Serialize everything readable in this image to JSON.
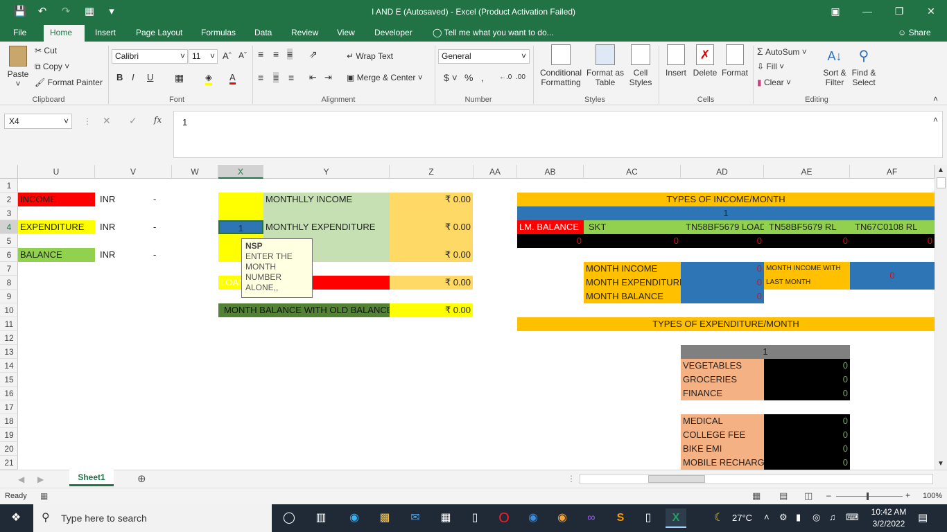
{
  "title": "I AND E (Autosaved) - Excel (Product Activation Failed)",
  "tabs": [
    "File",
    "Home",
    "Insert",
    "Page Layout",
    "Formulas",
    "Data",
    "Review",
    "View",
    "Developer"
  ],
  "tell_me": "Tell me what you want to do...",
  "share": "Share",
  "ribbon": {
    "paste": "Paste",
    "cut": "Cut",
    "copy": "Copy",
    "format_painter": "Format Painter",
    "clipboard": "Clipboard",
    "font_name": "Calibri",
    "font_size": "11",
    "font": "Font",
    "wrap_text": "Wrap Text",
    "merge_center": "Merge & Center",
    "alignment": "Alignment",
    "number_format": "General",
    "number": "Number",
    "cond_fmt_1": "Conditional",
    "cond_fmt_2": "Formatting",
    "fmt_table_1": "Format as",
    "fmt_table_2": "Table",
    "cell_styles_1": "Cell",
    "cell_styles_2": "Styles",
    "styles": "Styles",
    "insert": "Insert",
    "delete": "Delete",
    "format": "Format",
    "cells": "Cells",
    "autosum": "AutoSum",
    "fill": "Fill",
    "clear": "Clear",
    "sort_1": "Sort &",
    "sort_2": "Filter",
    "find_1": "Find &",
    "find_2": "Select",
    "editing": "Editing"
  },
  "name_box": "X4",
  "formula": "1",
  "columns": [
    "U",
    "V",
    "W",
    "X",
    "Y",
    "Z",
    "AA",
    "AB",
    "AC",
    "AD",
    "AE",
    "AF"
  ],
  "rows": [
    "1",
    "2",
    "3",
    "4",
    "5",
    "6",
    "7",
    "8",
    "9",
    "10",
    "11",
    "12",
    "13",
    "14",
    "15",
    "16",
    "17",
    "18",
    "19",
    "20",
    "21"
  ],
  "cells": {
    "u2": "INCOME",
    "v2": "INR",
    "w2": "-",
    "u4": "EXPENDITURE",
    "v4": "INR",
    "w4": "-",
    "u6": "BALANCE",
    "v6": "INR",
    "w6": "-",
    "y2": "MONTHLLY INCOME",
    "z2": "₹ 0.00",
    "x4": "1",
    "y4": "MONTHLY EXPENDITURE",
    "z4": "₹ 0.00",
    "y6": "BALANCE",
    "z6": "₹ 0.00",
    "x8": "LOAN",
    "y8": "LOAN",
    "z8": "₹ 0.00",
    "x10": "MONTH BALANCE WITH OLD BALANCE",
    "z10": "₹ 0.00",
    "ab2": "TYPES OF INCOME/MONTH",
    "ab3": "1",
    "ab4": "LM. BALANCE",
    "ac4": "SKT",
    "ad4": "TN58BF5679 LOAD",
    "ae4": "TN58BF5679 RL",
    "af4": "TN67C0108 RL",
    "ab5": "0",
    "ac5": "0",
    "ad5": "0",
    "ae5": "0",
    "af5": "0",
    "ac7": "MONTH INCOME",
    "ad7": "0",
    "ac8": "MONTH EXPENDITURE",
    "ad8": "0",
    "ac9": "MONTH BALANCE",
    "ad9": "0",
    "ae7a": "MONTH INCOME WITH",
    "ae7b": "LAST MONTH BALANCES",
    "af7": "0",
    "ab11": "TYPES OF EXPENDITURE/MONTH",
    "ad13": "1",
    "exp": [
      [
        "VEGETABLES",
        "0"
      ],
      [
        "GROCERIES",
        "0"
      ],
      [
        "FINANCE",
        "0"
      ],
      [
        "",
        ""
      ],
      [
        "MEDICAL",
        "0"
      ],
      [
        "COLLEGE FEE",
        "0"
      ],
      [
        "BIKE EMI",
        "0"
      ],
      [
        "MOBILE RECHARGE",
        "0"
      ]
    ]
  },
  "tooltip": {
    "title": "NSP",
    "body": "ENTER THE MONTH NUMBER ALONE,,"
  },
  "sheet_tab": "Sheet1",
  "status": "Ready",
  "zoom": "100%",
  "taskbar": {
    "search": "Type here to search",
    "temp": "27°C",
    "time": "10:42 AM",
    "date": "3/2/2022"
  }
}
